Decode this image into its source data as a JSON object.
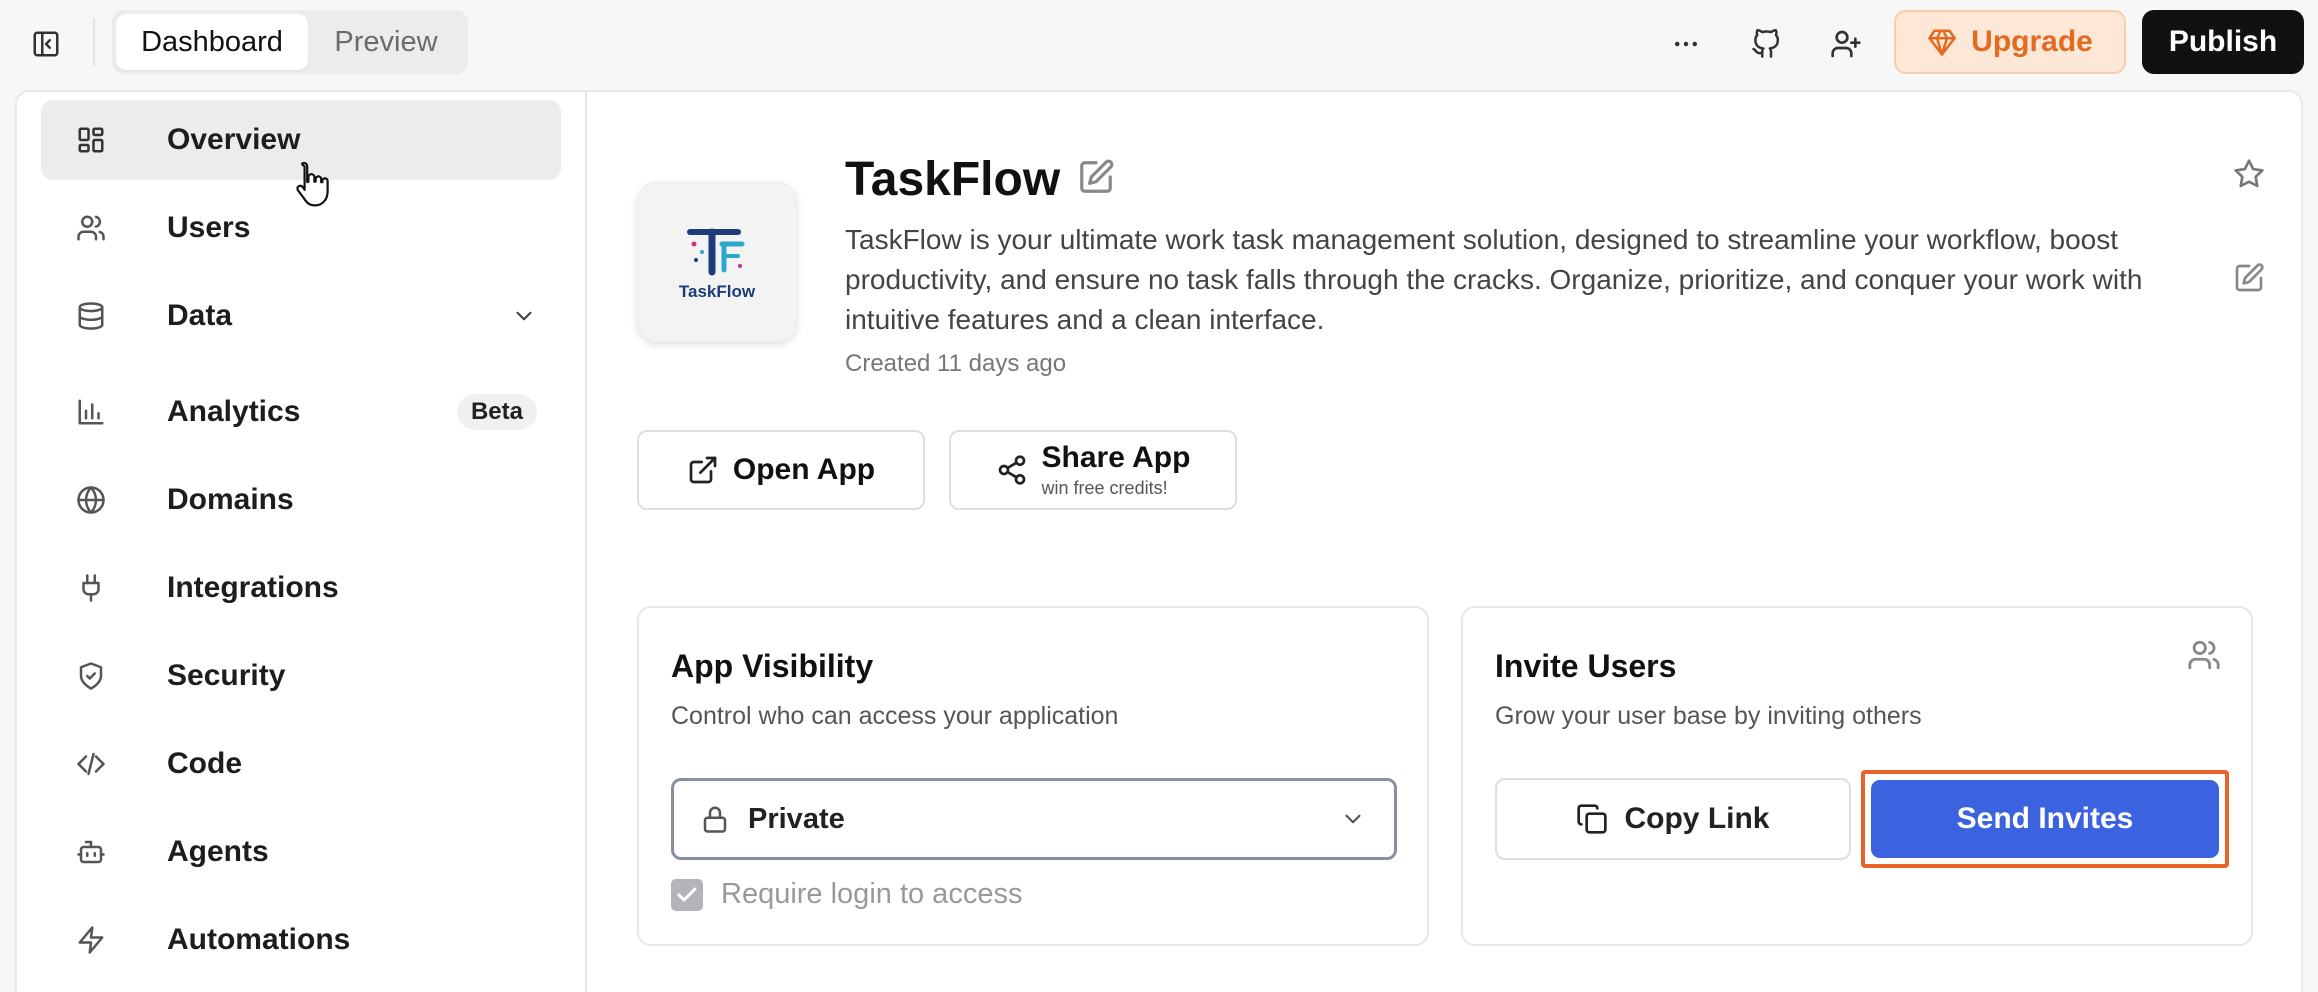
{
  "header": {
    "tabs": [
      {
        "label": "Dashboard",
        "active": true
      },
      {
        "label": "Preview",
        "active": false
      }
    ],
    "upgrade_label": "Upgrade",
    "publish_label": "Publish"
  },
  "sidebar": {
    "items": [
      {
        "label": "Overview",
        "icon": "layout-grid-icon",
        "active": true
      },
      {
        "label": "Users",
        "icon": "users-icon"
      },
      {
        "label": "Data",
        "icon": "database-icon",
        "expandable": true
      },
      {
        "label": "Analytics",
        "icon": "bar-chart-icon",
        "badge": "Beta"
      },
      {
        "label": "Domains",
        "icon": "globe-icon"
      },
      {
        "label": "Integrations",
        "icon": "plug-icon"
      },
      {
        "label": "Security",
        "icon": "shield-icon"
      },
      {
        "label": "Code",
        "icon": "code-icon"
      },
      {
        "label": "Agents",
        "icon": "bot-icon"
      },
      {
        "label": "Automations",
        "icon": "zap-icon"
      }
    ]
  },
  "app": {
    "name": "TaskFlow",
    "logo_text": "TaskFlow",
    "description": "TaskFlow is your ultimate work task management solution, designed to streamline your workflow, boost productivity, and ensure no task falls through the cracks. Organize, prioritize, and conquer your work with intuitive features and a clean interface.",
    "created": "Created 11 days ago",
    "open_app_label": "Open App",
    "share_app_label": "Share App",
    "share_app_sub": "win free credits!"
  },
  "visibility": {
    "title": "App Visibility",
    "subtitle": "Control who can access your application",
    "selected": "Private",
    "require_login_label": "Require login to access",
    "require_login_checked": true
  },
  "invite": {
    "title": "Invite Users",
    "subtitle": "Grow your user base by inviting others",
    "copy_link_label": "Copy Link",
    "send_invites_label": "Send Invites"
  },
  "colors": {
    "accent": "#3b63e0",
    "upgrade": "#e46a1f",
    "highlight": "#e8622a"
  }
}
